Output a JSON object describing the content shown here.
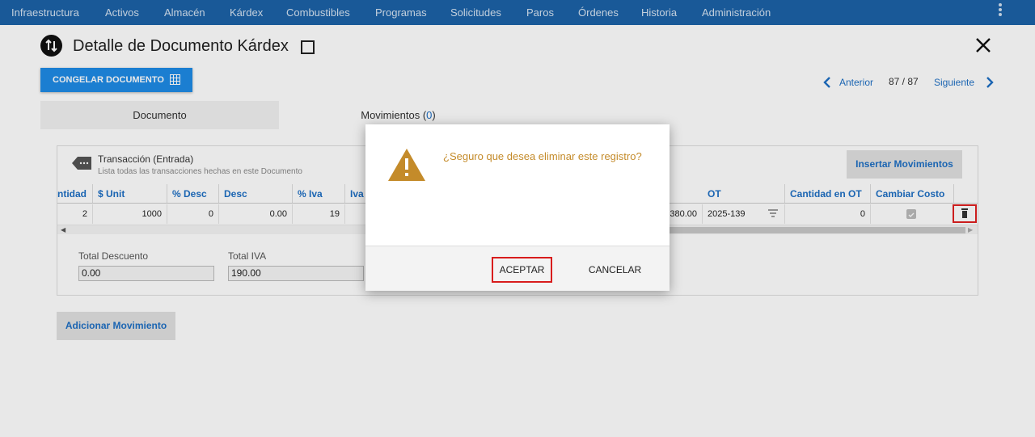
{
  "nav": {
    "items": [
      "Infraestructura",
      "Activos",
      "Almacén",
      "Kárdex",
      "Combustibles",
      "Programas",
      "Solicitudes",
      "Paros",
      "Órdenes",
      "Historia",
      "Administración"
    ]
  },
  "header": {
    "title": "Detalle de Documento Kárdex",
    "freeze_label": "CONGELAR DOCUMENTO"
  },
  "pager": {
    "prev_label": "Anterior",
    "count": "87 / 87",
    "next_label": "Siguiente"
  },
  "tabs": {
    "documento": "Documento",
    "movimientos": "Movimientos",
    "movimientos_count_open": "(",
    "movimientos_count": "0",
    "movimientos_count_close": ")"
  },
  "transaction": {
    "title": "Transacción (Entrada)",
    "subtitle": "Lista todas las transacciones hechas en este Documento",
    "insert_label": "Insertar Movimientos"
  },
  "grid": {
    "columns": {
      "cantidad": "ntidad",
      "unit": "$ Unit",
      "pdesc": "% Desc",
      "desc": "Desc",
      "piva": "% Iva",
      "iva": "Iva",
      "ot": "OT",
      "cant_ot": "Cantidad en OT",
      "cambiar_costo": "Cambiar Costo"
    },
    "row": {
      "cantidad": "2",
      "unit": "1000",
      "pdesc": "0",
      "desc": "0.00",
      "piva": "19",
      "total": "380.00",
      "ot": "2025-139",
      "cant_ot": "0"
    }
  },
  "totals": {
    "descuento_label": "Total Descuento",
    "descuento_value": "0.00",
    "iva_label": "Total IVA",
    "iva_value": "190.00"
  },
  "add_label": "Adicionar Movimiento",
  "modal": {
    "message": "¿Seguro que desea eliminar este registro?",
    "accept_label": "ACEPTAR",
    "cancel_label": "CANCELAR"
  },
  "colors": {
    "nav_bg": "#1c62a8",
    "accent": "#1e8be6",
    "link": "#1e6fc4",
    "warning": "#c48b2a",
    "highlight": "#d81c1c"
  }
}
